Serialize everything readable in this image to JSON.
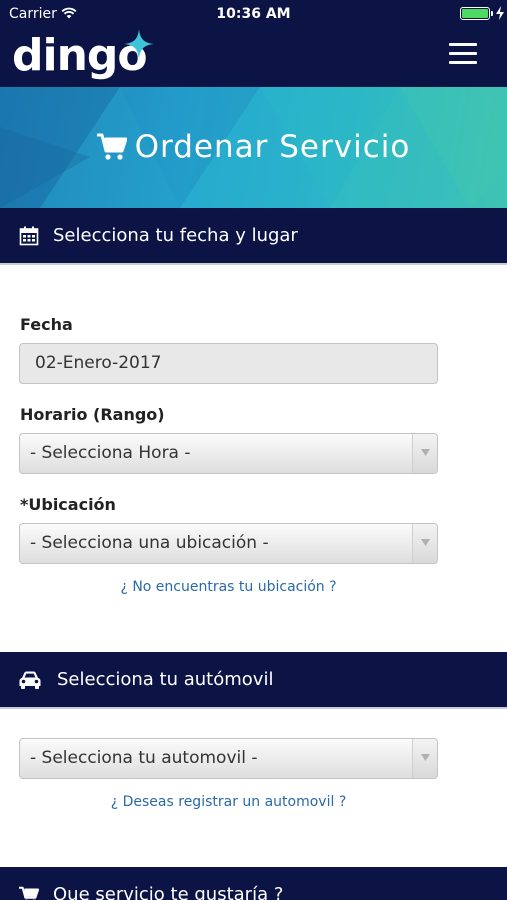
{
  "status_bar": {
    "carrier": "Carrier",
    "time": "10:36 AM"
  },
  "nav": {
    "logo": "dingo",
    "brand_color": "#0c1446",
    "accent_color": "#3ec4d8"
  },
  "hero": {
    "title": "Ordenar Servicio",
    "icon": "cart-icon"
  },
  "section_date": {
    "title": "Selecciona tu fecha y lugar",
    "icon": "calendar-icon"
  },
  "form": {
    "fecha_label": "Fecha",
    "fecha_value": "02-Enero-2017",
    "horario_label": "Horario (Rango)",
    "horario_value": "- Selecciona Hora -",
    "ubicacion_label": "*Ubicación",
    "ubicacion_value": "- Selecciona una ubicación -",
    "ubicacion_link": "¿ No encuentras tu ubicación ?"
  },
  "section_car": {
    "title": "Selecciona tu autómovil",
    "icon": "car-icon",
    "select_value": "- Selecciona tu automovil -",
    "link": "¿ Deseas registrar un automovil ?"
  },
  "section_service": {
    "title": "Que servicio te gustaría ?",
    "icon": "cart-icon"
  }
}
